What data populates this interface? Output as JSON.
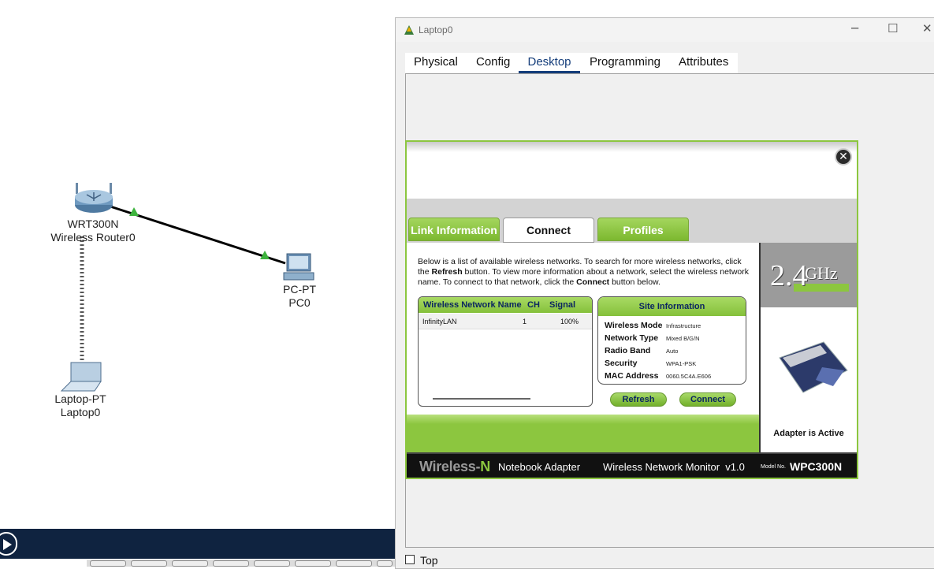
{
  "topology": {
    "router": {
      "model": "WRT300N",
      "name": "Wireless Router0"
    },
    "pc": {
      "model": "PC-PT",
      "name": "PC0"
    },
    "laptop": {
      "model": "Laptop-PT",
      "name": "Laptop0"
    }
  },
  "window": {
    "title": "Laptop0",
    "tabs": [
      "Physical",
      "Config",
      "Desktop",
      "Programming",
      "Attributes"
    ],
    "active_tab": "Desktop",
    "top_checkbox_label": "Top"
  },
  "wireless_app": {
    "tabs": [
      "Link Information",
      "Connect",
      "Profiles"
    ],
    "active_tab": "Connect",
    "band_big": "2.4",
    "band_unit": "GHz",
    "description": {
      "p1": "Below is a list of available wireless networks. To search for more wireless networks, click the ",
      "b1": "Refresh",
      "p2": " button. To view more information about a network, select the wireless network name. To connect to that network, click the ",
      "b2": "Connect",
      "p3": " button below."
    },
    "network_table": {
      "headers": [
        "Wireless Network Name",
        "CH",
        "Signal"
      ],
      "rows": [
        [
          "InfinityLAN",
          "1",
          "100%"
        ]
      ]
    },
    "site_info": {
      "title": "Site Information",
      "fields": [
        {
          "label": "Wireless Mode",
          "value": "Infrastructure"
        },
        {
          "label": "Network Type",
          "value": "Mixed B/G/N"
        },
        {
          "label": "Radio Band",
          "value": "Auto"
        },
        {
          "label": "Security",
          "value": "WPA1-PSK"
        },
        {
          "label": "MAC Address",
          "value": "0060.5C4A.E606"
        }
      ]
    },
    "buttons": {
      "refresh": "Refresh",
      "connect": "Connect"
    },
    "adapter_status": "Adapter is Active",
    "footer": {
      "brand_a": "Wireless-",
      "brand_b": "N",
      "product": "Notebook Adapter",
      "monitor": "Wireless Network Monitor  v1.0",
      "model_label": "Model No.",
      "model_no": "WPC300N"
    }
  },
  "colors": {
    "accent_green": "#8cc63f",
    "tab_blue": "#143d7a",
    "taskbar": "#0f2340"
  }
}
